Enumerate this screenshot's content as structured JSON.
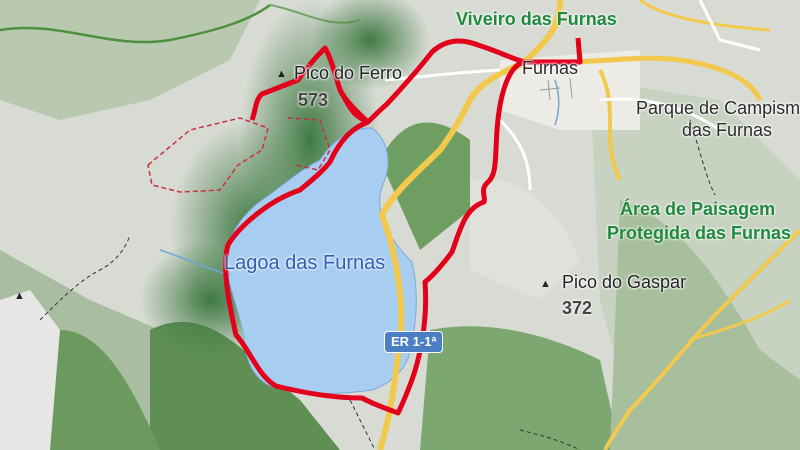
{
  "map": {
    "colors": {
      "water": "#a7cdf0",
      "route": "#e3001b",
      "major_road": "#f2c94c",
      "green_label": "#1f8a3c",
      "boundary_dashed": "#c8323c"
    },
    "labels": {
      "viveiro": "Viveiro das Furnas",
      "furnas": "Furnas",
      "pico_ferro_name": "Pico do Ferro",
      "pico_ferro_elev": "573",
      "parque_line1": "Parque de Campismo",
      "parque_line2": "das Furnas",
      "area_line1": "Área de Paisagem",
      "area_line2": "Protegida das Furnas",
      "lake": "Lagoa das Furnas",
      "pico_gaspar_name": "Pico do Gaspar",
      "pico_gaspar_elev": "372",
      "road_shield": "ER 1-1ª"
    },
    "icons": [
      "summit-triangle-icon",
      "summit-triangle-icon",
      "summit-triangle-icon",
      "road-shield-icon"
    ]
  }
}
